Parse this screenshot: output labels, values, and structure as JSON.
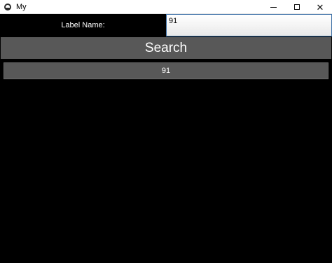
{
  "window": {
    "title": "My",
    "icon": "app-icon",
    "controls": {
      "minimize": "minimize-icon",
      "maximize": "maximize-icon",
      "close": "close-icon"
    }
  },
  "form": {
    "label": "Label Name:",
    "input_value": "91"
  },
  "search": {
    "label": "Search"
  },
  "results": [
    {
      "text": "91"
    }
  ],
  "colors": {
    "background": "#000000",
    "button": "#585858",
    "text": "#ffffff"
  }
}
